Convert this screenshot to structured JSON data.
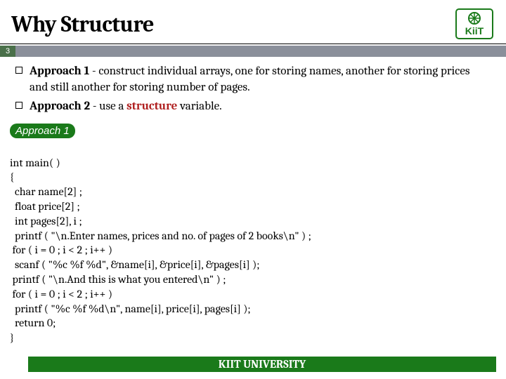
{
  "title": "Why Structure",
  "slide_number": "3",
  "bullets": [
    {
      "label": "Approach 1",
      "text": " - construct individual arrays, one for storing names, another for storing prices and still another for storing number of pages."
    },
    {
      "label": "Approach 2",
      "text_before": " - use a ",
      "struct_word": "structure",
      "text_after": " variable."
    }
  ],
  "code_label": "Approach 1",
  "code_lines": [
    "int main( )",
    "{",
    "  char name[2] ;",
    "  float price[2] ;",
    "  int pages[2], i ;",
    "  printf ( \"\\n.Enter names, prices and no. of pages of 2 books\\n\" ) ;",
    " for ( i = 0 ; i < 2 ; i++ )",
    "  scanf ( \"%c %f %d\", &name[i], &price[i], &pages[i] );",
    " printf ( \"\\n.And this is what you entered\\n\" ) ;",
    " for ( i = 0 ; i < 2 ; i++ )",
    "  printf ( \"%c %f %d\\n\", name[i], price[i], pages[i] );",
    "  return 0;",
    "}"
  ],
  "footer": "KIIT UNIVERSITY"
}
